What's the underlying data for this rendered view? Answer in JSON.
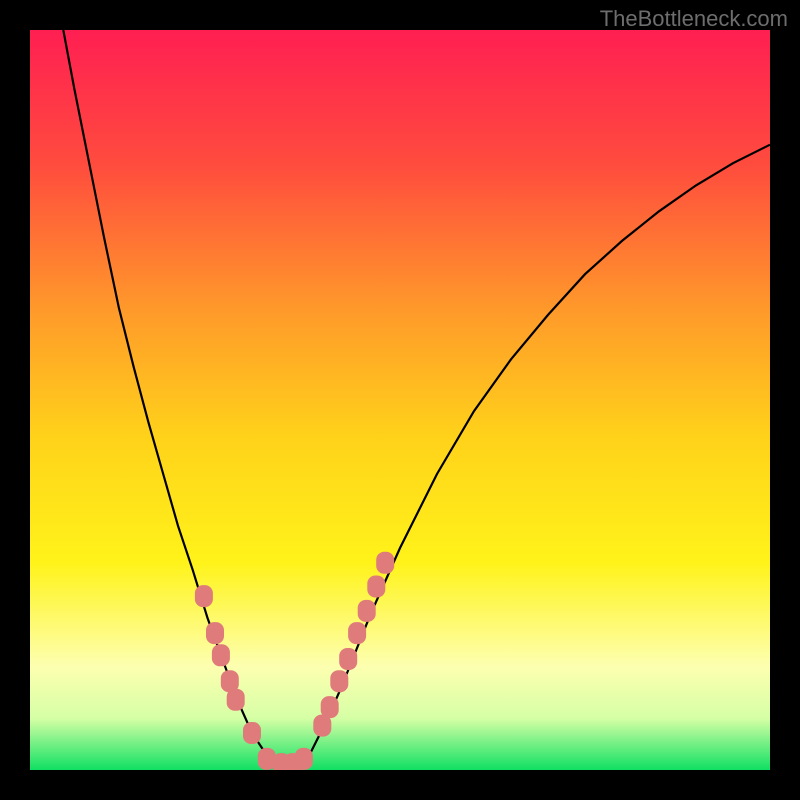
{
  "watermark": "TheBottleneck.com",
  "colors": {
    "frame": "#000000",
    "gradient_stops": [
      {
        "offset": 0.0,
        "color": "#ff1f52"
      },
      {
        "offset": 0.18,
        "color": "#ff4b3e"
      },
      {
        "offset": 0.38,
        "color": "#ff9a2a"
      },
      {
        "offset": 0.55,
        "color": "#ffd21a"
      },
      {
        "offset": 0.72,
        "color": "#fff31a"
      },
      {
        "offset": 0.86,
        "color": "#fdffb0"
      },
      {
        "offset": 0.93,
        "color": "#d6ffa5"
      },
      {
        "offset": 1.0,
        "color": "#10e063"
      }
    ],
    "curve": "#000000",
    "markers": "#e07b7b"
  },
  "chart_data": {
    "type": "line",
    "title": "",
    "xlabel": "",
    "ylabel": "",
    "xlim": [
      0,
      1
    ],
    "ylim": [
      0,
      1
    ],
    "curve_left": [
      {
        "x": 0.045,
        "y": 1.0
      },
      {
        "x": 0.06,
        "y": 0.92
      },
      {
        "x": 0.08,
        "y": 0.82
      },
      {
        "x": 0.1,
        "y": 0.72
      },
      {
        "x": 0.12,
        "y": 0.625
      },
      {
        "x": 0.14,
        "y": 0.545
      },
      {
        "x": 0.16,
        "y": 0.47
      },
      {
        "x": 0.18,
        "y": 0.4
      },
      {
        "x": 0.2,
        "y": 0.33
      },
      {
        "x": 0.22,
        "y": 0.27
      },
      {
        "x": 0.24,
        "y": 0.205
      },
      {
        "x": 0.26,
        "y": 0.15
      },
      {
        "x": 0.28,
        "y": 0.095
      },
      {
        "x": 0.3,
        "y": 0.05
      },
      {
        "x": 0.32,
        "y": 0.02
      },
      {
        "x": 0.34,
        "y": 0.005
      }
    ],
    "curve_right": [
      {
        "x": 0.36,
        "y": 0.005
      },
      {
        "x": 0.38,
        "y": 0.025
      },
      {
        "x": 0.4,
        "y": 0.065
      },
      {
        "x": 0.42,
        "y": 0.11
      },
      {
        "x": 0.44,
        "y": 0.16
      },
      {
        "x": 0.46,
        "y": 0.21
      },
      {
        "x": 0.5,
        "y": 0.3
      },
      {
        "x": 0.55,
        "y": 0.4
      },
      {
        "x": 0.6,
        "y": 0.485
      },
      {
        "x": 0.65,
        "y": 0.555
      },
      {
        "x": 0.7,
        "y": 0.615
      },
      {
        "x": 0.75,
        "y": 0.67
      },
      {
        "x": 0.8,
        "y": 0.715
      },
      {
        "x": 0.85,
        "y": 0.755
      },
      {
        "x": 0.9,
        "y": 0.79
      },
      {
        "x": 0.95,
        "y": 0.82
      },
      {
        "x": 1.0,
        "y": 0.845
      }
    ],
    "markers": [
      {
        "x": 0.235,
        "y": 0.235
      },
      {
        "x": 0.25,
        "y": 0.185
      },
      {
        "x": 0.258,
        "y": 0.155
      },
      {
        "x": 0.27,
        "y": 0.12
      },
      {
        "x": 0.278,
        "y": 0.095
      },
      {
        "x": 0.3,
        "y": 0.05
      },
      {
        "x": 0.32,
        "y": 0.015
      },
      {
        "x": 0.34,
        "y": 0.008
      },
      {
        "x": 0.355,
        "y": 0.008
      },
      {
        "x": 0.37,
        "y": 0.015
      },
      {
        "x": 0.395,
        "y": 0.06
      },
      {
        "x": 0.405,
        "y": 0.085
      },
      {
        "x": 0.418,
        "y": 0.12
      },
      {
        "x": 0.43,
        "y": 0.15
      },
      {
        "x": 0.442,
        "y": 0.185
      },
      {
        "x": 0.455,
        "y": 0.215
      },
      {
        "x": 0.468,
        "y": 0.248
      },
      {
        "x": 0.48,
        "y": 0.28
      }
    ]
  }
}
